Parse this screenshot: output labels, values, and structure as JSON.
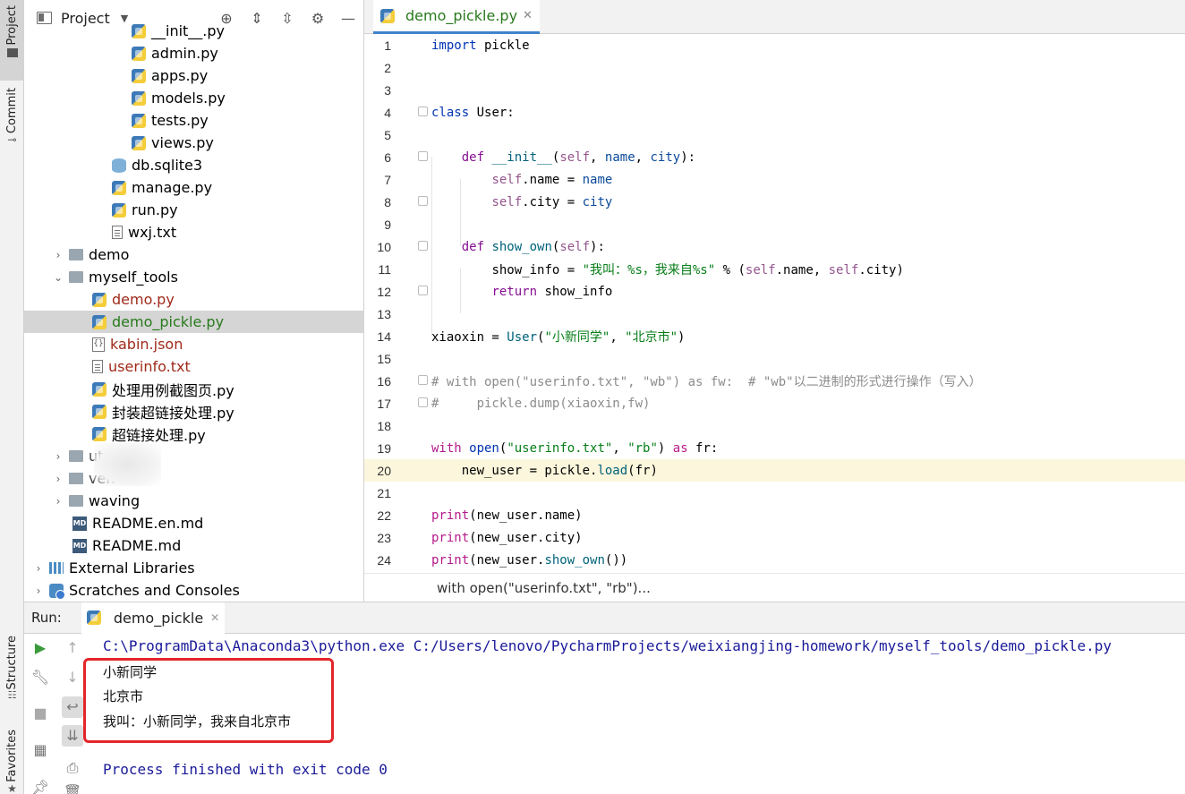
{
  "left_strip": {
    "project": "Project",
    "commit": "Commit",
    "structure": "Structure",
    "favorites": "Favorites"
  },
  "project_panel": {
    "title": "Project",
    "tree": [
      {
        "label": "__init__.py",
        "icon": "python-file-icon",
        "indent": 120,
        "arrow": ""
      },
      {
        "label": "admin.py",
        "icon": "python-file-icon",
        "indent": 120,
        "arrow": ""
      },
      {
        "label": "apps.py",
        "icon": "python-file-icon",
        "indent": 120,
        "arrow": ""
      },
      {
        "label": "models.py",
        "icon": "python-file-icon",
        "indent": 120,
        "arrow": ""
      },
      {
        "label": "tests.py",
        "icon": "python-file-icon",
        "indent": 120,
        "arrow": ""
      },
      {
        "label": "views.py",
        "icon": "python-file-icon",
        "indent": 120,
        "arrow": ""
      },
      {
        "label": "db.sqlite3",
        "icon": "database-icon",
        "indent": 98,
        "arrow": ""
      },
      {
        "label": "manage.py",
        "icon": "python-file-icon",
        "indent": 98,
        "arrow": ""
      },
      {
        "label": "run.py",
        "icon": "python-file-icon",
        "indent": 98,
        "arrow": ""
      },
      {
        "label": "wxj.txt",
        "icon": "text-file-icon",
        "indent": 98,
        "arrow": ""
      },
      {
        "label": "demo",
        "icon": "folder-icon",
        "indent": 32,
        "arrow": "›"
      },
      {
        "label": "myself_tools",
        "icon": "folder-icon",
        "indent": 32,
        "arrow": "⌄"
      },
      {
        "label": "demo.py",
        "icon": "python-file-icon",
        "indent": 76,
        "arrow": "",
        "color": "red"
      },
      {
        "label": "demo_pickle.py",
        "icon": "python-file-icon",
        "indent": 76,
        "arrow": "",
        "color": "green",
        "selected": true
      },
      {
        "label": "kabin.json",
        "icon": "json-file-icon",
        "indent": 76,
        "arrow": "",
        "color": "red"
      },
      {
        "label": "userinfo.txt",
        "icon": "text-file-icon",
        "indent": 76,
        "arrow": "",
        "color": "red"
      },
      {
        "label": "处理用例截图页.py",
        "icon": "python-file-icon",
        "indent": 76,
        "arrow": ""
      },
      {
        "label": "封装超链接处理.py",
        "icon": "python-file-icon",
        "indent": 76,
        "arrow": ""
      },
      {
        "label": "超链接处理.py",
        "icon": "python-file-icon",
        "indent": 76,
        "arrow": ""
      },
      {
        "label": "utotest",
        "icon": "folder-icon",
        "indent": 32,
        "arrow": "›",
        "blurred": true
      },
      {
        "label": "ven",
        "icon": "folder-icon",
        "indent": 32,
        "arrow": "›",
        "blurred": true
      },
      {
        "label": "waving",
        "icon": "folder-icon",
        "indent": 32,
        "arrow": "›"
      },
      {
        "label": "README.en.md",
        "icon": "markdown-file-icon",
        "indent": 54,
        "arrow": ""
      },
      {
        "label": "README.md",
        "icon": "markdown-file-icon",
        "indent": 54,
        "arrow": ""
      },
      {
        "label": "External Libraries",
        "icon": "library-icon",
        "indent": 10,
        "arrow": "›"
      },
      {
        "label": "Scratches and Consoles",
        "icon": "scratches-icon",
        "indent": 10,
        "arrow": "›"
      }
    ]
  },
  "editor": {
    "tab_label": "demo_pickle.py",
    "current_line": 20,
    "breadcrumb": "with open(\"userinfo.txt\", \"rb\")...",
    "lines": [
      {
        "n": "1"
      },
      {
        "n": "2"
      },
      {
        "n": "3"
      },
      {
        "n": "4"
      },
      {
        "n": "5"
      },
      {
        "n": "6"
      },
      {
        "n": "7"
      },
      {
        "n": "8"
      },
      {
        "n": "9"
      },
      {
        "n": "10"
      },
      {
        "n": "11"
      },
      {
        "n": "12"
      },
      {
        "n": "13"
      },
      {
        "n": "14"
      },
      {
        "n": "15"
      },
      {
        "n": "16"
      },
      {
        "n": "17"
      },
      {
        "n": "18"
      },
      {
        "n": "19"
      },
      {
        "n": "20"
      },
      {
        "n": "21"
      },
      {
        "n": "22"
      },
      {
        "n": "23"
      },
      {
        "n": "24"
      }
    ],
    "code": {
      "l1_kw": "import",
      "l1_rest": " pickle",
      "l4_kw": "class",
      "l4_rest": " User:",
      "l6_kw": "def",
      "l6_fn": "__init__",
      "l6_a": "(",
      "l6_self": "self",
      "l6_b": ", ",
      "l6_p1": "name",
      "l6_c": ", ",
      "l6_p2": "city",
      "l6_d": "):",
      "l7_self": "self",
      "l7_a": ".name = ",
      "l7_p": "name",
      "l8_self": "self",
      "l8_a": ".city = ",
      "l8_p": "city",
      "l10_kw": "def",
      "l10_fn": "show_own",
      "l10_a": "(",
      "l10_self": "self",
      "l10_b": "):",
      "l11_a": "show_info = ",
      "l11_str": "\"我叫：%s，我来自%s\"",
      "l11_b": " % (",
      "l11_self1": "self",
      "l11_c": ".name, ",
      "l11_self2": "self",
      "l11_d": ".city)",
      "l12_kw": "return",
      "l12_rest": " show_info",
      "l14_a": "xiaoxin = ",
      "l14_fn": "User",
      "l14_b": "(",
      "l14_s1": "\"小新同学\"",
      "l14_c": ", ",
      "l14_s2": "\"北京市\"",
      "l14_d": ")",
      "l16": "# with open(\"userinfo.txt\", \"wb\") as fw:  # \"wb\"以二进制的形式进行操作（写入）",
      "l17": "#     pickle.dump(xiaoxin,fw)",
      "l19_kw": "with",
      "l19_fn": " open",
      "l19_a": "(",
      "l19_s1": "\"userinfo.txt\"",
      "l19_b": ", ",
      "l19_s2": "\"rb\"",
      "l19_c": ") ",
      "l19_kw2": "as",
      "l19_d": " fr:",
      "l20_a": "new_user = pickle.",
      "l20_fn": "load",
      "l20_b": "(fr)",
      "l22_fn": "print",
      "l22_a": "(new_user.name)",
      "l23_fn": "print",
      "l23_a": "(new_user.city)",
      "l24_fn": "print",
      "l24_a": "(new_user.",
      "l24_m": "show_own",
      "l24_b": "())"
    }
  },
  "run_panel": {
    "label": "Run:",
    "tab": "demo_pickle",
    "command": "C:\\ProgramData\\Anaconda3\\python.exe C:/Users/lenovo/PycharmProjects/weixiangjing-homework/myself_tools/demo_pickle.py",
    "output": [
      "小新同学",
      "北京市",
      "我叫：小新同学，我来自北京市"
    ],
    "exit": "Process finished with exit code 0"
  },
  "colors": {
    "accent": "#4083c9",
    "highlight_box": "#e3262a",
    "current_line_bg": "#fcf6dc"
  }
}
